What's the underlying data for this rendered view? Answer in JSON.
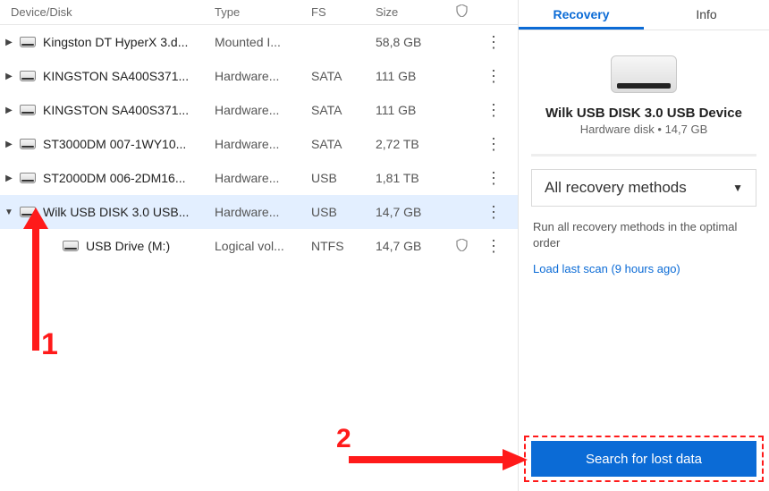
{
  "headers": {
    "device": "Device/Disk",
    "type": "Type",
    "fs": "FS",
    "size": "Size"
  },
  "rows": [
    {
      "name": "Kingston DT HyperX 3.d...",
      "type": "Mounted I...",
      "fs": "",
      "size": "58,8 GB",
      "selected": false,
      "child": false,
      "expander": "right"
    },
    {
      "name": "KINGSTON  SA400S371...",
      "type": "Hardware...",
      "fs": "SATA",
      "size": "111 GB",
      "selected": false,
      "child": false,
      "expander": "right"
    },
    {
      "name": "KINGSTON  SA400S371...",
      "type": "Hardware...",
      "fs": "SATA",
      "size": "111 GB",
      "selected": false,
      "child": false,
      "expander": "right"
    },
    {
      "name": "ST3000DM 007-1WY10...",
      "type": "Hardware...",
      "fs": "SATA",
      "size": "2,72 TB",
      "selected": false,
      "child": false,
      "expander": "right"
    },
    {
      "name": "ST2000DM 006-2DM16...",
      "type": "Hardware...",
      "fs": "USB",
      "size": "1,81 TB",
      "selected": false,
      "child": false,
      "expander": "right"
    },
    {
      "name": "Wilk USB DISK 3.0 USB...",
      "type": "Hardware...",
      "fs": "USB",
      "size": "14,7 GB",
      "selected": true,
      "child": false,
      "expander": "down"
    },
    {
      "name": "USB Drive (M:)",
      "type": "Logical vol...",
      "fs": "NTFS",
      "size": "14,7 GB",
      "selected": false,
      "child": true,
      "shield": true,
      "expander": "none"
    }
  ],
  "tabs": {
    "recovery": "Recovery",
    "info": "Info"
  },
  "device": {
    "title": "Wilk USB DISK 3.0 USB Device",
    "subtitle": "Hardware disk • 14,7 GB"
  },
  "method": {
    "label": "All recovery methods"
  },
  "description": "Run all recovery methods in the optimal order",
  "link": "Load last scan (9 hours ago)",
  "search_button": "Search for lost data",
  "annotations": {
    "one": "1",
    "two": "2"
  }
}
